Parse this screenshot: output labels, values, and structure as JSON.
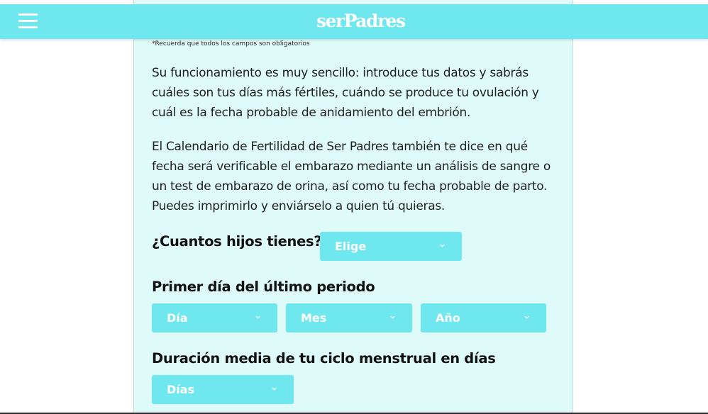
{
  "header": {
    "logo": "serPadres",
    "menu_icon": "hamburger-menu-icon"
  },
  "form": {
    "required_note": "*Recuerda que todos los campos son obligatorios",
    "intro_paragraph": "Su funcionamiento es muy sencillo: introduce tus datos y sabrás cuáles son tus días más fértiles, cuándo se produce tu ovulación y cuál es la fecha probable de anidamiento del embrión.",
    "detail_paragraph": "El Calendario de Fertilidad de Ser Padres también te dice en qué fecha será verificable el embarazo mediante un análisis de sangre o un test de embarazo de orina, así como tu fecha probable de parto. Puedes imprimirlo y enviárselo a quien tú quieras.",
    "children_question": "¿Cuantos hijos tienes?",
    "children_select": "Elige",
    "period_question": "Primer día del último periodo",
    "day_select": "Día",
    "month_select": "Mes",
    "year_select": "Año",
    "cycle_question": "Duración media de tu ciclo menstrual en días",
    "days_select": "Días"
  },
  "colors": {
    "accent": "#6ee7ee",
    "panel_background": "#defbf9",
    "text": "#1f1f1f"
  }
}
